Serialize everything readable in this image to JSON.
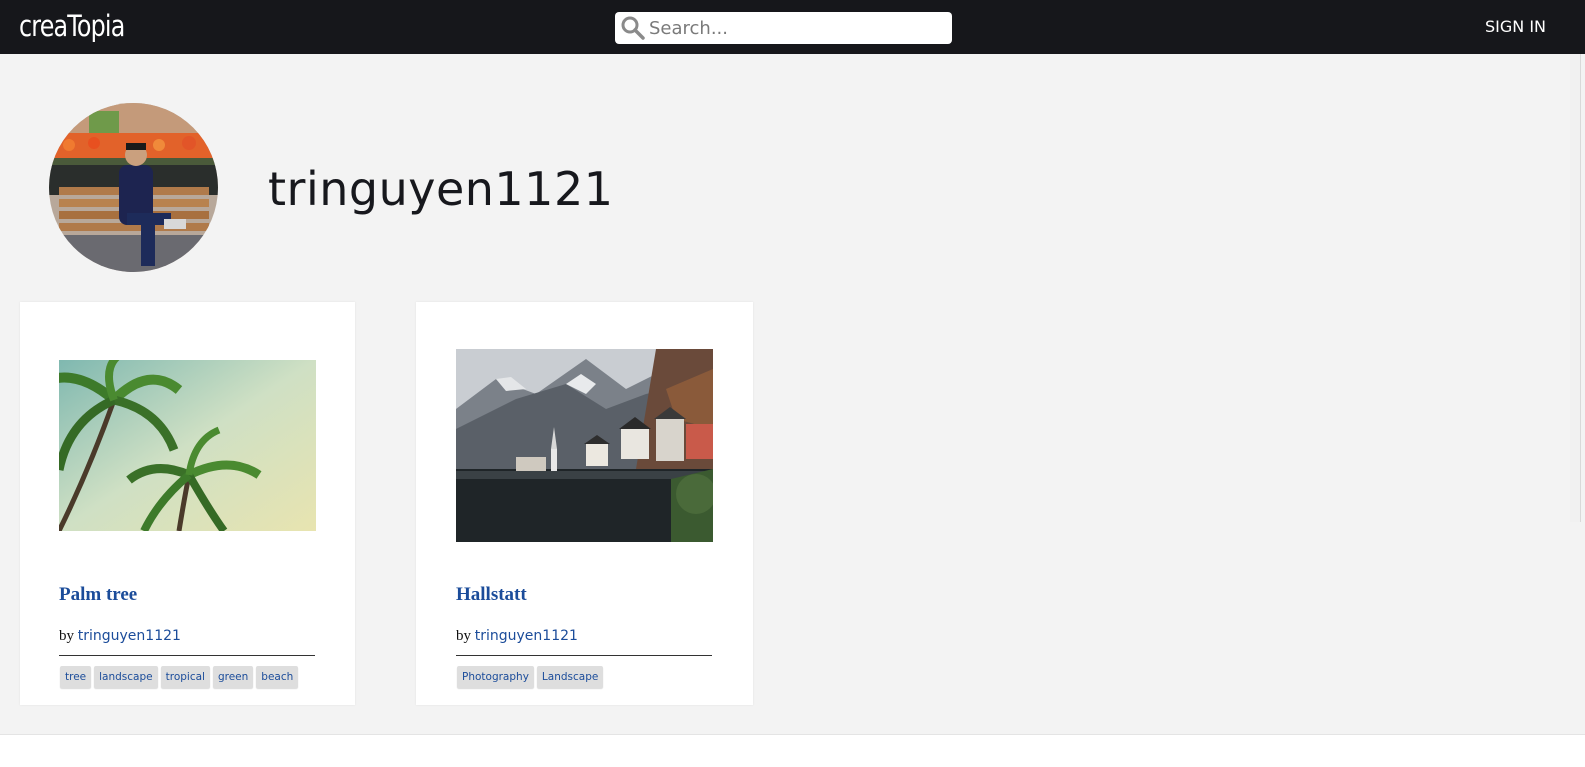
{
  "header": {
    "logo": "creaTopia",
    "search_placeholder": "Search...",
    "signin_label": "SIGN IN"
  },
  "profile": {
    "username": "tringuyen1121"
  },
  "posts": [
    {
      "title": "Palm tree",
      "by_label": "by",
      "author": "tringuyen1121",
      "tags": [
        "tree",
        "landscape",
        "tropical",
        "green",
        "beach"
      ]
    },
    {
      "title": "Hallstatt",
      "by_label": "by",
      "author": "tringuyen1121",
      "tags": [
        "Photography",
        "Landscape"
      ]
    }
  ],
  "colors": {
    "topbar": "#16171b",
    "background": "#f3f3f3",
    "link": "#1b4c9a"
  }
}
